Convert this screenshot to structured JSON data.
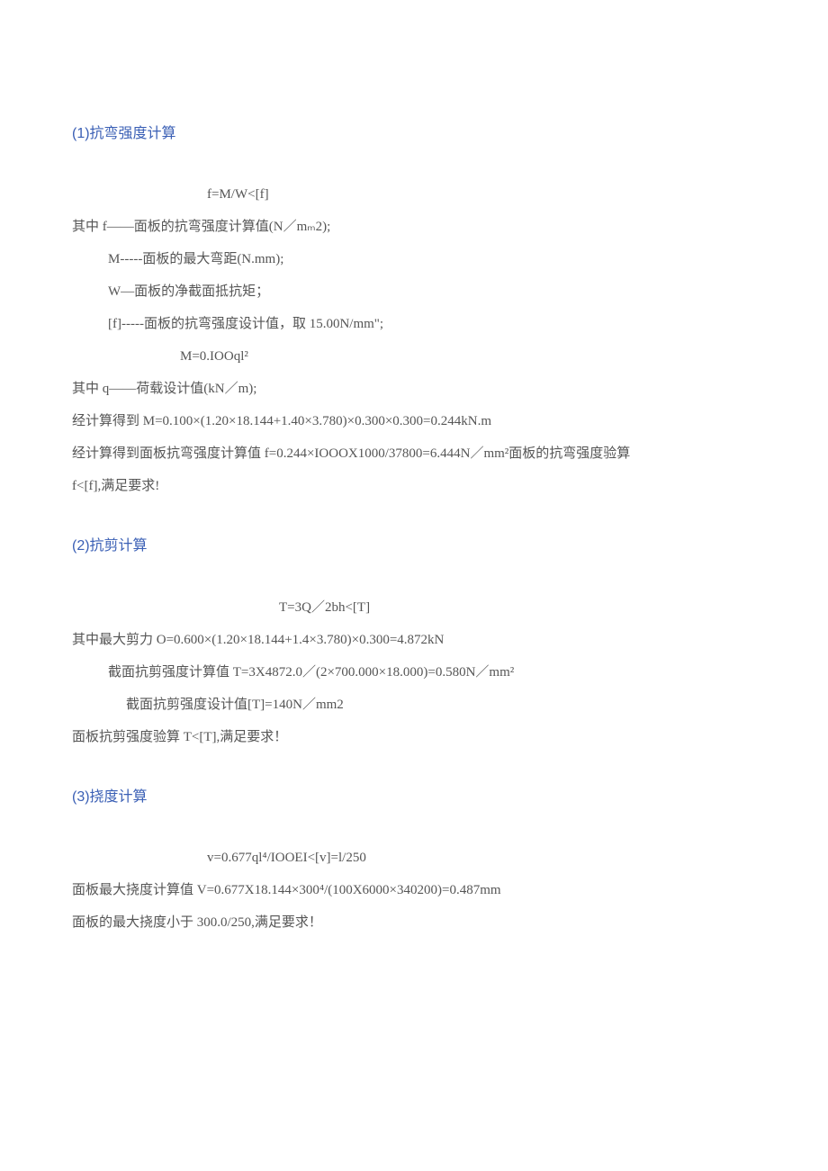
{
  "s1": {
    "heading": "(1)抗弯强度计算",
    "f1": "f=M/W<[f]",
    "l1": "其中 f——面板的抗弯强度计算值(N／mₘ2);",
    "l2": "M-----面板的最大弯距(N.mm);",
    "l3": "W—面板的净截面抵抗矩；",
    "l4": "[f]-----面板的抗弯强度设计值，取 15.00N/mm\";",
    "f2": "M=0.IOOql²",
    "l5": "其中 q——荷载设计值(kN／m);",
    "l6": "经计算得到 M=0.100×(1.20×18.144+1.40×3.780)×0.300×0.300=0.244kN.m",
    "l7": "经计算得到面板抗弯强度计算值 f=0.244×IOOOX1000/37800=6.444N／mm²面板的抗弯强度验算",
    "l8": "f<[f],满足要求!"
  },
  "s2": {
    "heading": "(2)抗剪计算",
    "f1": "T=3Q／2bh<[T]",
    "l1": "其中最大剪力 O=0.600×(1.20×18.144+1.4×3.780)×0.300=4.872kN",
    "l2": "截面抗剪强度计算值 T=3X4872.0／(2×700.000×18.000)=0.580N／mm²",
    "l3": "截面抗剪强度设计值[T]=140N／mm2",
    "l4": "面板抗剪强度验算 T<[T],满足要求！"
  },
  "s3": {
    "heading": "(3)挠度计算",
    "f1": "v=0.677ql⁴/IOOEI<[v]=l/250",
    "l1": "面板最大挠度计算值 V=0.677X18.144×300⁴/(100X6000×340200)=0.487mm",
    "l2": "面板的最大挠度小于 300.0/250,满足要求！"
  }
}
